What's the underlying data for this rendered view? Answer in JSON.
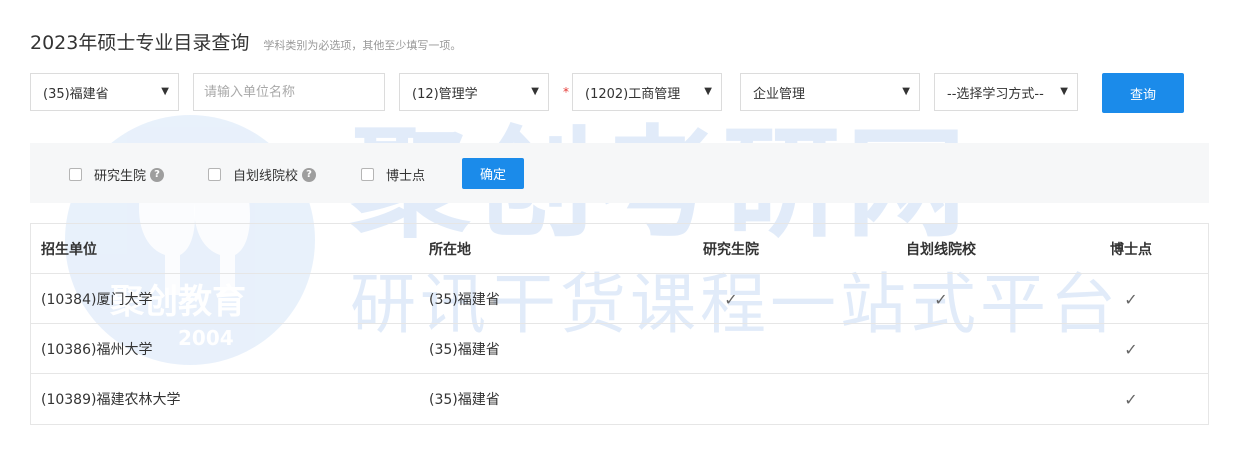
{
  "header": {
    "title": "2023年硕士专业目录查询",
    "subtitle": "学科类别为必选项，其他至少填写一项。"
  },
  "filters": {
    "province": "(35)福建省",
    "unit_placeholder": "请输入单位名称",
    "category": "(12)管理学",
    "required_mark": "*",
    "discipline": "(1202)工商管理",
    "major": "企业管理",
    "study_mode": "--选择学习方式--",
    "caret": "▼",
    "query_button": "查询"
  },
  "options": {
    "grad_school": "研究生院",
    "self_line": "自划线院校",
    "doctoral": "博士点",
    "help_glyph": "?",
    "confirm_button": "确定"
  },
  "table": {
    "headers": [
      "招生单位",
      "所在地",
      "研究生院",
      "自划线院校",
      "博士点"
    ],
    "check_glyph": "✓",
    "rows": [
      {
        "unit": "(10384)厦门大学",
        "location": "(35)福建省",
        "grad_school": true,
        "self_line": true,
        "doctoral": true
      },
      {
        "unit": "(10386)福州大学",
        "location": "(35)福建省",
        "grad_school": false,
        "self_line": false,
        "doctoral": true
      },
      {
        "unit": "(10389)福建农林大学",
        "location": "(35)福建省",
        "grad_school": false,
        "self_line": false,
        "doctoral": true
      }
    ]
  },
  "watermark": {
    "main": "聚创考研网",
    "slogan": "研讯干货课程一站式平台",
    "logo_text": "聚创教育",
    "logo_year": "2004",
    "color": "#c9dcf5"
  }
}
